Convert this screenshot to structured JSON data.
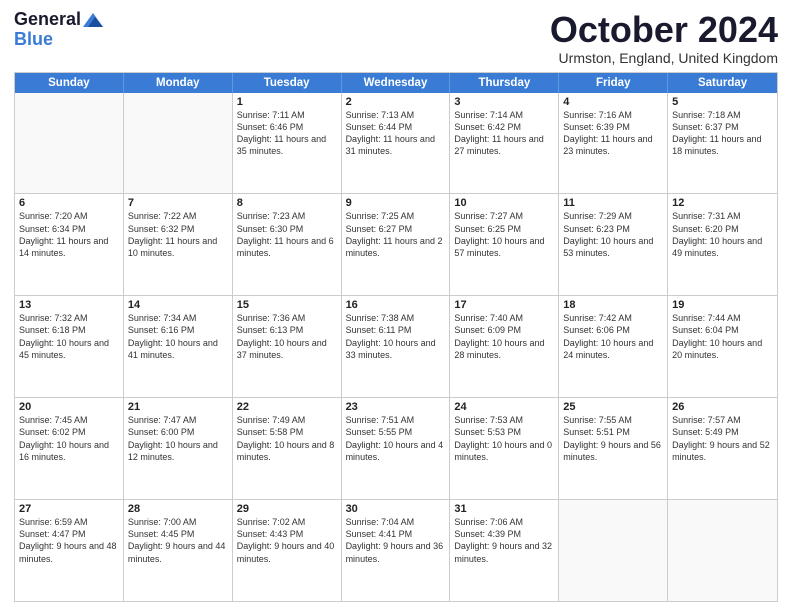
{
  "logo": {
    "general": "General",
    "blue": "Blue"
  },
  "header": {
    "month": "October 2024",
    "location": "Urmston, England, United Kingdom"
  },
  "days": [
    "Sunday",
    "Monday",
    "Tuesday",
    "Wednesday",
    "Thursday",
    "Friday",
    "Saturday"
  ],
  "weeks": [
    [
      {
        "day": "",
        "text": ""
      },
      {
        "day": "",
        "text": ""
      },
      {
        "day": "1",
        "text": "Sunrise: 7:11 AM\nSunset: 6:46 PM\nDaylight: 11 hours and 35 minutes."
      },
      {
        "day": "2",
        "text": "Sunrise: 7:13 AM\nSunset: 6:44 PM\nDaylight: 11 hours and 31 minutes."
      },
      {
        "day": "3",
        "text": "Sunrise: 7:14 AM\nSunset: 6:42 PM\nDaylight: 11 hours and 27 minutes."
      },
      {
        "day": "4",
        "text": "Sunrise: 7:16 AM\nSunset: 6:39 PM\nDaylight: 11 hours and 23 minutes."
      },
      {
        "day": "5",
        "text": "Sunrise: 7:18 AM\nSunset: 6:37 PM\nDaylight: 11 hours and 18 minutes."
      }
    ],
    [
      {
        "day": "6",
        "text": "Sunrise: 7:20 AM\nSunset: 6:34 PM\nDaylight: 11 hours and 14 minutes."
      },
      {
        "day": "7",
        "text": "Sunrise: 7:22 AM\nSunset: 6:32 PM\nDaylight: 11 hours and 10 minutes."
      },
      {
        "day": "8",
        "text": "Sunrise: 7:23 AM\nSunset: 6:30 PM\nDaylight: 11 hours and 6 minutes."
      },
      {
        "day": "9",
        "text": "Sunrise: 7:25 AM\nSunset: 6:27 PM\nDaylight: 11 hours and 2 minutes."
      },
      {
        "day": "10",
        "text": "Sunrise: 7:27 AM\nSunset: 6:25 PM\nDaylight: 10 hours and 57 minutes."
      },
      {
        "day": "11",
        "text": "Sunrise: 7:29 AM\nSunset: 6:23 PM\nDaylight: 10 hours and 53 minutes."
      },
      {
        "day": "12",
        "text": "Sunrise: 7:31 AM\nSunset: 6:20 PM\nDaylight: 10 hours and 49 minutes."
      }
    ],
    [
      {
        "day": "13",
        "text": "Sunrise: 7:32 AM\nSunset: 6:18 PM\nDaylight: 10 hours and 45 minutes."
      },
      {
        "day": "14",
        "text": "Sunrise: 7:34 AM\nSunset: 6:16 PM\nDaylight: 10 hours and 41 minutes."
      },
      {
        "day": "15",
        "text": "Sunrise: 7:36 AM\nSunset: 6:13 PM\nDaylight: 10 hours and 37 minutes."
      },
      {
        "day": "16",
        "text": "Sunrise: 7:38 AM\nSunset: 6:11 PM\nDaylight: 10 hours and 33 minutes."
      },
      {
        "day": "17",
        "text": "Sunrise: 7:40 AM\nSunset: 6:09 PM\nDaylight: 10 hours and 28 minutes."
      },
      {
        "day": "18",
        "text": "Sunrise: 7:42 AM\nSunset: 6:06 PM\nDaylight: 10 hours and 24 minutes."
      },
      {
        "day": "19",
        "text": "Sunrise: 7:44 AM\nSunset: 6:04 PM\nDaylight: 10 hours and 20 minutes."
      }
    ],
    [
      {
        "day": "20",
        "text": "Sunrise: 7:45 AM\nSunset: 6:02 PM\nDaylight: 10 hours and 16 minutes."
      },
      {
        "day": "21",
        "text": "Sunrise: 7:47 AM\nSunset: 6:00 PM\nDaylight: 10 hours and 12 minutes."
      },
      {
        "day": "22",
        "text": "Sunrise: 7:49 AM\nSunset: 5:58 PM\nDaylight: 10 hours and 8 minutes."
      },
      {
        "day": "23",
        "text": "Sunrise: 7:51 AM\nSunset: 5:55 PM\nDaylight: 10 hours and 4 minutes."
      },
      {
        "day": "24",
        "text": "Sunrise: 7:53 AM\nSunset: 5:53 PM\nDaylight: 10 hours and 0 minutes."
      },
      {
        "day": "25",
        "text": "Sunrise: 7:55 AM\nSunset: 5:51 PM\nDaylight: 9 hours and 56 minutes."
      },
      {
        "day": "26",
        "text": "Sunrise: 7:57 AM\nSunset: 5:49 PM\nDaylight: 9 hours and 52 minutes."
      }
    ],
    [
      {
        "day": "27",
        "text": "Sunrise: 6:59 AM\nSunset: 4:47 PM\nDaylight: 9 hours and 48 minutes."
      },
      {
        "day": "28",
        "text": "Sunrise: 7:00 AM\nSunset: 4:45 PM\nDaylight: 9 hours and 44 minutes."
      },
      {
        "day": "29",
        "text": "Sunrise: 7:02 AM\nSunset: 4:43 PM\nDaylight: 9 hours and 40 minutes."
      },
      {
        "day": "30",
        "text": "Sunrise: 7:04 AM\nSunset: 4:41 PM\nDaylight: 9 hours and 36 minutes."
      },
      {
        "day": "31",
        "text": "Sunrise: 7:06 AM\nSunset: 4:39 PM\nDaylight: 9 hours and 32 minutes."
      },
      {
        "day": "",
        "text": ""
      },
      {
        "day": "",
        "text": ""
      }
    ]
  ]
}
